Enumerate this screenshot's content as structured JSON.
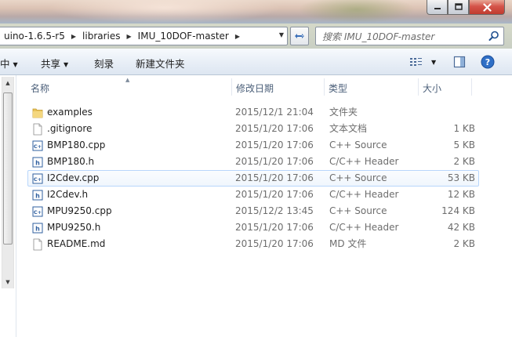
{
  "window": {
    "buttons": {
      "minimize": "—",
      "maximize": "□",
      "close": "✕"
    }
  },
  "address": {
    "crumbs": [
      "uino-1.6.5-r5",
      "libraries",
      "IMU_10DOF-master"
    ],
    "search_placeholder": "搜索 IMU_10DOF-master"
  },
  "toolbar": {
    "items": [
      {
        "label": "中",
        "has_dropdown": true
      },
      {
        "label": "共享",
        "has_dropdown": true
      },
      {
        "label": "刻录",
        "has_dropdown": false
      },
      {
        "label": "新建文件夹",
        "has_dropdown": false
      }
    ],
    "view_icon": "view-options-icon",
    "preview_icon": "preview-pane-icon",
    "help_icon": "help-icon"
  },
  "columns": {
    "name": "名称",
    "date": "修改日期",
    "type": "类型",
    "size": "大小"
  },
  "files": [
    {
      "name": "examples",
      "date": "2015/12/1 21:04",
      "type": "文件夹",
      "size": "",
      "icon": "folder-icon"
    },
    {
      "name": ".gitignore",
      "date": "2015/1/20 17:06",
      "type": "文本文档",
      "size": "1 KB",
      "icon": "text-file-icon"
    },
    {
      "name": "BMP180.cpp",
      "date": "2015/1/20 17:06",
      "type": "C++ Source",
      "size": "5 KB",
      "icon": "cpp-file-icon"
    },
    {
      "name": "BMP180.h",
      "date": "2015/1/20 17:06",
      "type": "C/C++ Header",
      "size": "2 KB",
      "icon": "header-file-icon"
    },
    {
      "name": "I2Cdev.cpp",
      "date": "2015/1/20 17:06",
      "type": "C++ Source",
      "size": "53 KB",
      "icon": "cpp-file-icon"
    },
    {
      "name": "I2Cdev.h",
      "date": "2015/1/20 17:06",
      "type": "C/C++ Header",
      "size": "12 KB",
      "icon": "header-file-icon"
    },
    {
      "name": "MPU9250.cpp",
      "date": "2015/12/2 13:45",
      "type": "C++ Source",
      "size": "124 KB",
      "icon": "cpp-file-icon"
    },
    {
      "name": "MPU9250.h",
      "date": "2015/1/20 17:06",
      "type": "C/C++ Header",
      "size": "42 KB",
      "icon": "header-file-icon"
    },
    {
      "name": "README.md",
      "date": "2015/1/20 17:06",
      "type": "MD 文件",
      "size": "2 KB",
      "icon": "text-file-icon"
    }
  ],
  "hovered_row": 4,
  "colors": {
    "accent_blue": "#3a6fb8",
    "folder_yellow": "#e9c35a",
    "hover_border": "#b8d6fb"
  }
}
